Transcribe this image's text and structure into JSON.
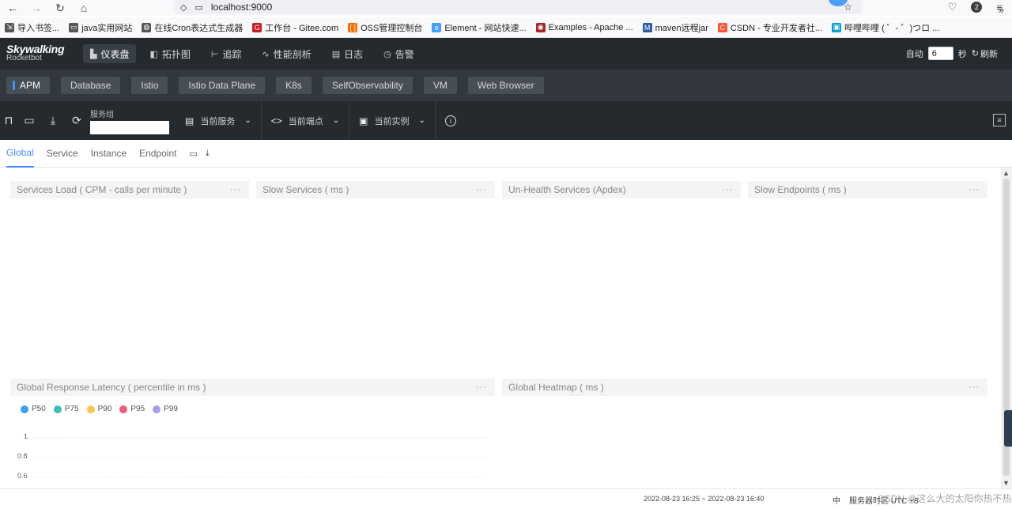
{
  "browser": {
    "url": "localhost:9000",
    "profile_badge": "2",
    "bookmarks": [
      {
        "label": "导入书签...",
        "icon": "import-icon",
        "color": "#555555"
      },
      {
        "label": "java实用网站",
        "icon": "folder-icon",
        "color": "#555555"
      },
      {
        "label": "在线Cron表达式生成器",
        "icon": "globe-icon",
        "color": "#555555"
      },
      {
        "label": "工作台 - Gitee.com",
        "icon": "gitee-icon",
        "color": "#c71d23"
      },
      {
        "label": "OSS管理控制台",
        "icon": "aliyun-icon",
        "color": "#ff6a00"
      },
      {
        "label": "Element - 网站快速...",
        "icon": "element-icon",
        "color": "#409eff"
      },
      {
        "label": "Examples - Apache ...",
        "icon": "apache-icon",
        "color": "#a3262c"
      },
      {
        "label": "maven远程jar",
        "icon": "maven-icon",
        "color": "#2c5aa0"
      },
      {
        "label": "CSDN - 专业开发者社...",
        "icon": "csdn-icon",
        "color": "#fc5531"
      },
      {
        "label": "哔哩哔哩 ( ゜- ゜)つロ ...",
        "icon": "bilibili-icon",
        "color": "#00a1d6"
      }
    ]
  },
  "app": {
    "logo_line1": "Skywalking",
    "logo_line2": "Rocketbot",
    "nav": [
      {
        "label": "仪表盘",
        "icon": "chart-icon",
        "active": true
      },
      {
        "label": "拓扑图",
        "icon": "topology-icon",
        "active": false
      },
      {
        "label": "追踪",
        "icon": "trace-icon",
        "active": false
      },
      {
        "label": "性能剖析",
        "icon": "profile-icon",
        "active": false
      },
      {
        "label": "日志",
        "icon": "log-icon",
        "active": false
      },
      {
        "label": "告警",
        "icon": "alarm-icon",
        "active": false
      }
    ],
    "auto_label": "自动",
    "interval_value": "6",
    "seconds_label": "秒",
    "refresh_label": "刷新"
  },
  "dashboard_tabs": [
    "APM",
    "Database",
    "Istio",
    "Istio Data Plane",
    "K8s",
    "SelfObservability",
    "VM",
    "Web Browser"
  ],
  "toolbar": {
    "group_label": "服务组",
    "group_value": "",
    "service_label": "当前服务",
    "endpoint_label": "当前端点",
    "instance_label": "当前实例"
  },
  "sub_tabs": [
    "Global",
    "Service",
    "Instance",
    "Endpoint"
  ],
  "panels": {
    "p1": "Services Load ( CPM - calls per minute )",
    "p2": "Slow Services ( ms )",
    "p3": "Un-Health Services (Apdex)",
    "p4": "Slow Endpoints ( ms )",
    "p5": "Global Response Latency ( percentile in ms )",
    "p6": "Global Heatmap ( ms )"
  },
  "chart_data": {
    "type": "line",
    "title": "Global Response Latency ( percentile in ms )",
    "series": [
      {
        "name": "P50",
        "color": "#3aa0e8",
        "values": []
      },
      {
        "name": "P75",
        "color": "#3dbdb6",
        "values": []
      },
      {
        "name": "P90",
        "color": "#fcc44e",
        "values": []
      },
      {
        "name": "P95",
        "color": "#f05b77",
        "values": []
      },
      {
        "name": "P99",
        "color": "#a99cea",
        "values": []
      }
    ],
    "y_ticks": [
      "1",
      "0.8",
      "0.6"
    ],
    "legend_position": "top-left"
  },
  "footer": {
    "time_range": "2022-08-23 16:25 ~ 2022-08-23 16:40",
    "lang": "中",
    "timezone": "服务器时区 UTC +8",
    "watermark": "CSDN @这么大的太阳你热不热"
  }
}
